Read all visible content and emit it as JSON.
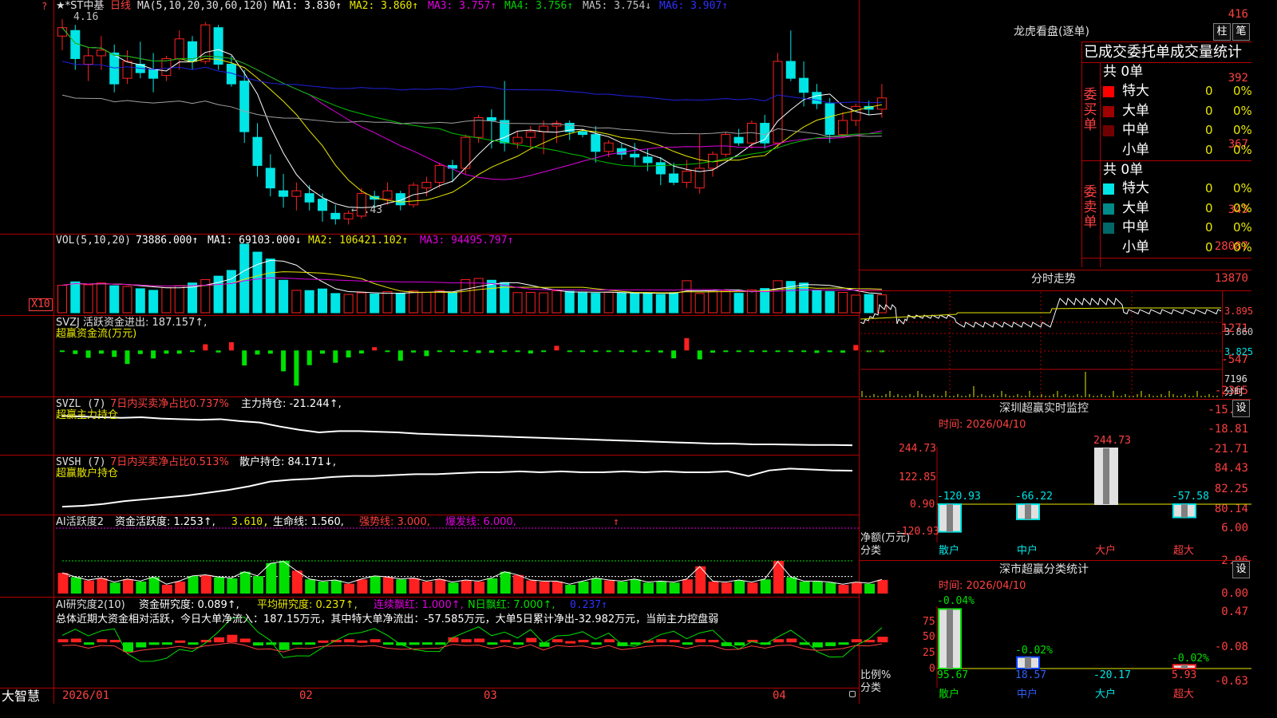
{
  "stock": {
    "name": "★*ST中基",
    "period": "日线",
    "bullet": "?"
  },
  "main": {
    "ma_label": "MA(5,10,20,30,60,120)",
    "ma1": "MA1: 3.830↑",
    "ma2": "MA2: 3.860↑",
    "ma3": "MA3: 3.757↑",
    "ma4": "MA4: 3.756↑",
    "ma5": "MA5: 3.754↓",
    "ma6": "MA6: 3.907↑",
    "yticks": [
      "416",
      "392",
      "367",
      "343"
    ],
    "high_mark": "4.16",
    "low_mark": "←3.43"
  },
  "vol": {
    "label": "VOL(5,10,20)",
    "val": "73886.000↑",
    "ma1": "MA1: 69103.000↓",
    "ma2": "MA2: 106421.102↑",
    "ma3": "MA3: 94495.797↑",
    "yticks": [
      "28087",
      "13870"
    ],
    "unit": "X10"
  },
  "svzj": {
    "label": "SVZJ  活跃资金进出: 187.157↑,",
    "sub": "超赢资金流(万元)",
    "yticks": [
      "1271",
      "-547",
      "-2365"
    ]
  },
  "svzl": {
    "label": "SVZL (7)",
    "pct": "7日内买卖净占比0.737%",
    "hold": "主力持仓: -21.244↑,",
    "sub": "超赢主力持仓",
    "yticks": [
      "-15.92",
      "-18.81",
      "-21.71"
    ]
  },
  "svsh": {
    "label": "SVSH (7)",
    "pct": "7日内买卖净占比0.513%",
    "hold": "散户持仓: 84.171↓,",
    "sub": "超赢散户持仓",
    "yticks": [
      "84.43",
      "82.25",
      "80.14"
    ]
  },
  "ai1": {
    "label": "AI活跃度2",
    "a": "资金活跃度: 1.253↑,",
    "b": "3.610,",
    "c": "生命线: 1.560,",
    "d": "强势线: 3.000,",
    "e": "爆发线: 6.000,",
    "f": "↑",
    "yticks": [
      "6.00",
      "2.96",
      "0.00"
    ]
  },
  "ai2": {
    "label": "AI研究度2(10)",
    "a": "资金研究度: 0.089↑,",
    "b": "平均研究度: 0.237↑,",
    "c": "连续飘红: 1.000↑,",
    "d": "N日飘红: 7.000↑,",
    "e": "0.237↑",
    "summary": "总体近期大资金相对活跃，今日大单净流入：187.15万元，其中特大单净流出：-57.585万元，大单5日累计净出-32.982万元，当前主力控盘弱",
    "yticks": [
      "0.47",
      "-0.08",
      "-0.63"
    ]
  },
  "xaxis": {
    "brand": "大智慧",
    "labels": [
      "2026/01",
      "02",
      "03",
      "04"
    ]
  },
  "side": {
    "title": "龙虎看盘(逐单)",
    "btn1": "柱",
    "btn2": "笔",
    "header": "已成交委托单成交量统计",
    "buy": {
      "label": "委买单",
      "count": "共 0单",
      "rows": [
        {
          "name": "特大",
          "v": "0",
          "p": "0%",
          "color": "#ff0000"
        },
        {
          "name": "大单",
          "v": "0",
          "p": "0%",
          "color": "#a00000"
        },
        {
          "name": "中单",
          "v": "0",
          "p": "0%",
          "color": "#700000"
        },
        {
          "name": "小单",
          "v": "0",
          "p": "0%",
          "color": "#000000"
        }
      ]
    },
    "sell": {
      "label": "委卖单",
      "count": "共 0单",
      "rows": [
        {
          "name": "特大",
          "v": "0",
          "p": "0%",
          "color": "#00e5e5"
        },
        {
          "name": "大单",
          "v": "0",
          "p": "0%",
          "color": "#008a8a"
        },
        {
          "name": "中单",
          "v": "0",
          "p": "0%",
          "color": "#006868"
        },
        {
          "name": "小单",
          "v": "0",
          "p": "0%",
          "color": "#000000"
        }
      ]
    },
    "intraday": {
      "title": "分时走势",
      "yticks": [
        "3.895",
        "3.860",
        "3.825"
      ],
      "vol": "7196",
      "unit": "分时"
    },
    "monitor": {
      "title": "深圳超赢实时监控",
      "btn": "设",
      "time": "时间: 2026/04/10",
      "yticks": [
        "244.73",
        "122.85",
        "0.90",
        "-120.93"
      ],
      "ylabel": "净额(万元)",
      "xlabel": "分类",
      "cats": [
        "散户",
        "中户",
        "大户",
        "超大"
      ],
      "vals": [
        "-120.93",
        "-66.22",
        "244.73",
        "-57.58"
      ]
    },
    "classify": {
      "title": "深市超赢分类统计",
      "btn": "设",
      "time": "时间: 2026/04/10",
      "yticks": [
        "75",
        "50",
        "25",
        "0"
      ],
      "ylabel": "比例%",
      "xlabel": "分类",
      "cats": [
        "散户",
        "中户",
        "大户",
        "超大"
      ],
      "tops": [
        "-0.04%",
        "-0.02%",
        "-0.02%"
      ],
      "vals": [
        "95.67",
        "18.57",
        "-20.17",
        "5.93"
      ]
    }
  },
  "colors": {
    "up": "#ff2020",
    "down": "#00e5e5",
    "green": "#00e000",
    "frame": "#b00000",
    "ma1": "#ffffff",
    "ma2": "#e8e800",
    "ma3": "#e000e0",
    "ma4": "#00c000",
    "ma5": "#a0a0a0",
    "ma6": "#2020e0"
  },
  "chart_data": [
    {
      "type": "candlestick",
      "title": "★*ST中基 日线",
      "ylim": [
        3.4,
        4.2
      ],
      "ohlc": [
        [
          4.1,
          4.16,
          4.05,
          4.13
        ],
        [
          4.12,
          4.14,
          3.98,
          4.02
        ],
        [
          4.0,
          4.06,
          3.94,
          4.03
        ],
        [
          4.03,
          4.1,
          3.98,
          4.05
        ],
        [
          4.04,
          4.07,
          3.9,
          3.93
        ],
        [
          3.95,
          4.05,
          3.93,
          4.01
        ],
        [
          4.0,
          4.08,
          3.95,
          3.97
        ],
        [
          3.98,
          4.04,
          3.9,
          3.95
        ],
        [
          3.96,
          4.03,
          3.94,
          4.02
        ],
        [
          4.02,
          4.12,
          3.98,
          4.09
        ],
        [
          4.08,
          4.1,
          3.98,
          4.01
        ],
        [
          4.01,
          4.15,
          4.0,
          4.14
        ],
        [
          4.13,
          4.14,
          3.98,
          4.0
        ],
        [
          4.0,
          4.03,
          3.92,
          3.93
        ],
        [
          3.94,
          3.98,
          3.72,
          3.76
        ],
        [
          3.74,
          3.79,
          3.6,
          3.64
        ],
        [
          3.63,
          3.68,
          3.53,
          3.56
        ],
        [
          3.55,
          3.61,
          3.49,
          3.53
        ],
        [
          3.53,
          3.58,
          3.48,
          3.55
        ],
        [
          3.54,
          3.57,
          3.48,
          3.51
        ],
        [
          3.52,
          3.54,
          3.44,
          3.48
        ],
        [
          3.47,
          3.5,
          3.43,
          3.45
        ],
        [
          3.45,
          3.48,
          3.43,
          3.47
        ],
        [
          3.46,
          3.56,
          3.45,
          3.54
        ],
        [
          3.53,
          3.55,
          3.49,
          3.52
        ],
        [
          3.52,
          3.58,
          3.5,
          3.55
        ],
        [
          3.54,
          3.55,
          3.48,
          3.5
        ],
        [
          3.5,
          3.58,
          3.49,
          3.57
        ],
        [
          3.56,
          3.6,
          3.53,
          3.58
        ],
        [
          3.58,
          3.65,
          3.56,
          3.64
        ],
        [
          3.64,
          3.66,
          3.58,
          3.63
        ],
        [
          3.63,
          3.75,
          3.61,
          3.74
        ],
        [
          3.74,
          3.82,
          3.72,
          3.81
        ],
        [
          3.81,
          3.84,
          3.7,
          3.8
        ],
        [
          3.8,
          3.94,
          3.69,
          3.72
        ],
        [
          3.72,
          3.76,
          3.7,
          3.74
        ],
        [
          3.74,
          3.78,
          3.7,
          3.76
        ],
        [
          3.76,
          3.8,
          3.68,
          3.78
        ],
        [
          3.78,
          3.8,
          3.72,
          3.79
        ],
        [
          3.79,
          3.8,
          3.73,
          3.76
        ],
        [
          3.76,
          3.77,
          3.74,
          3.75
        ],
        [
          3.75,
          3.78,
          3.65,
          3.69
        ],
        [
          3.69,
          3.73,
          3.67,
          3.72
        ],
        [
          3.7,
          3.72,
          3.66,
          3.68
        ],
        [
          3.68,
          3.72,
          3.64,
          3.67
        ],
        [
          3.67,
          3.7,
          3.62,
          3.65
        ],
        [
          3.65,
          3.67,
          3.57,
          3.61
        ],
        [
          3.61,
          3.65,
          3.57,
          3.58
        ],
        [
          3.58,
          3.66,
          3.56,
          3.62
        ],
        [
          3.56,
          3.75,
          3.54,
          3.63
        ],
        [
          3.63,
          3.69,
          3.6,
          3.68
        ],
        [
          3.68,
          3.76,
          3.67,
          3.75
        ],
        [
          3.74,
          3.77,
          3.71,
          3.72
        ],
        [
          3.72,
          3.8,
          3.7,
          3.79
        ],
        [
          3.79,
          3.82,
          3.7,
          3.72
        ],
        [
          3.72,
          4.04,
          3.7,
          4.01
        ],
        [
          4.01,
          4.12,
          3.94,
          3.95
        ],
        [
          3.95,
          4.01,
          3.85,
          3.9
        ],
        [
          3.9,
          3.93,
          3.84,
          3.86
        ],
        [
          3.86,
          3.88,
          3.72,
          3.75
        ],
        [
          3.75,
          3.83,
          3.74,
          3.8
        ],
        [
          3.8,
          3.86,
          3.78,
          3.85
        ],
        [
          3.85,
          3.87,
          3.82,
          3.84
        ],
        [
          3.84,
          3.93,
          3.81,
          3.88
        ]
      ]
    },
    {
      "type": "bar",
      "title": "VOL(5,10,20)",
      "ylim": [
        0,
        30000
      ],
      "values": [
        12000,
        13500,
        12200,
        13000,
        11800,
        11500,
        10500,
        9800,
        11000,
        11800,
        13000,
        14500,
        16000,
        18500,
        30000,
        26500,
        23500,
        14200,
        9800,
        9700,
        10400,
        8400,
        8000,
        8700,
        8200,
        9200,
        8500,
        9500,
        9000,
        9700,
        8800,
        14500,
        15000,
        14200,
        13200,
        8800,
        8900,
        8700,
        9600,
        9400,
        8700,
        8500,
        8900,
        8600,
        8400,
        8600,
        8000,
        8800,
        14000,
        8400,
        9200,
        9700,
        8500,
        10000,
        10600,
        14000,
        13700,
        13000,
        9800,
        9300,
        8900,
        7700,
        8000,
        7800
      ]
    },
    {
      "type": "bar",
      "title": "超赢资金流(万元)",
      "ylim": [
        -2365,
        1271
      ],
      "values": [
        -80,
        -210,
        -430,
        -190,
        -380,
        -790,
        -210,
        -470,
        -190,
        -190,
        -95,
        360,
        -120,
        480,
        -880,
        -240,
        -190,
        -1220,
        -2060,
        -860,
        -190,
        -720,
        -410,
        -180,
        190,
        -95,
        -600,
        -120,
        -330,
        -95,
        -45,
        -45,
        -150,
        -140,
        -80,
        -95,
        -180,
        -95,
        270,
        -95,
        -95,
        -90,
        -95,
        -45,
        -100,
        -45,
        -120,
        -460,
        720,
        -520,
        -130,
        -95,
        -20,
        -95,
        -45,
        -90,
        -45,
        -95,
        -145,
        -100,
        -130,
        320,
        -95,
        -100
      ]
    },
    {
      "type": "line",
      "title": "超赢主力持仓",
      "ylim": [
        -21.71,
        -15.92
      ],
      "values": [
        -16.8,
        -16.9,
        -17.0,
        -17.1,
        -17.0,
        -17.2,
        -17.3,
        -17.4,
        -17.3,
        -17.6,
        -17.8,
        -18.4,
        -18.9,
        -19.3,
        -19.1,
        -19.1,
        -19.2,
        -19.3,
        -19.5,
        -19.6,
        -19.7,
        -19.8,
        -19.9,
        -20.0,
        -20.1,
        -20.2,
        -20.3,
        -20.4,
        -20.5,
        -20.6,
        -20.7,
        -20.8,
        -20.9,
        -21.0,
        -21.0,
        -21.1,
        -21.1,
        -21.15,
        -21.2,
        -21.2,
        -21.244
      ]
    },
    {
      "type": "line",
      "title": "超赢散户持仓",
      "ylim": [
        80.14,
        84.43
      ],
      "values": [
        80.3,
        80.4,
        80.6,
        80.9,
        81.1,
        81.3,
        81.5,
        81.8,
        82.1,
        82.5,
        83.0,
        83.2,
        83.3,
        83.5,
        83.6,
        83.6,
        83.7,
        83.8,
        83.8,
        83.9,
        84.0,
        84.0,
        84.1,
        84.0,
        84.1,
        84.0,
        84.0,
        84.1,
        84.0,
        84.1,
        84.0,
        84.0,
        84.1,
        83.6,
        84.2,
        84.4,
        84.3,
        84.2,
        84.171
      ]
    },
    {
      "type": "bar",
      "title": "AI活跃度2",
      "ylim": [
        0,
        6.0
      ],
      "values": [
        1.9,
        1.5,
        1.2,
        1.4,
        1.0,
        1.3,
        1.1,
        1.5,
        0.8,
        1.1,
        1.6,
        1.7,
        1.5,
        1.4,
        2.0,
        1.6,
        2.8,
        3.0,
        2.1,
        1.3,
        1.1,
        1.2,
        0.9,
        1.3,
        1.6,
        1.5,
        1.3,
        1.4,
        1.1,
        1.3,
        1.0,
        1.2,
        1.1,
        1.4,
        2.0,
        1.7,
        1.2,
        1.1,
        1.1,
        0.8,
        1.1,
        1.4,
        1.2,
        1.1,
        1.3,
        1.0,
        1.1,
        1.0,
        1.3,
        2.5,
        1.1,
        1.0,
        1.2,
        1.0,
        1.3,
        3.0,
        1.5,
        1.1,
        1.1,
        1.0,
        0.8,
        1.0,
        0.9,
        1.253
      ]
    },
    {
      "type": "bar",
      "title": "AI研究度2(10)",
      "ylim": [
        -0.63,
        0.47
      ],
      "values": [
        0.05,
        0.06,
        -0.02,
        0.05,
        0.04,
        -0.15,
        -0.08,
        -0.04,
        -0.02,
        0.03,
        -0.03,
        0.04,
        0.08,
        0.12,
        0.06,
        -0.05,
        -0.04,
        -0.12,
        -0.02,
        -0.03,
        0.03,
        0.04,
        0.05,
        0.03,
        0.05,
        -0.02,
        -0.05,
        -0.04,
        -0.03,
        -0.02,
        0.08,
        0.05,
        0.06,
        -0.03,
        0.04,
        -0.02,
        0.07,
        -0.07,
        0.05,
        0.02,
        0.04,
        -0.03,
        0.05,
        -0.06,
        -0.02,
        0.03,
        0.05,
        0.04,
        -0.03,
        0.05,
        0.04,
        -0.06,
        -0.05,
        0.04,
        -0.02,
        0.05,
        0.06,
        -0.04,
        -0.08,
        -0.06,
        -0.03,
        0.05,
        0.04,
        0.089
      ]
    },
    {
      "type": "bar",
      "title": "深圳超赢实时监控",
      "categories": [
        "散户",
        "中户",
        "大户",
        "超大"
      ],
      "values": [
        -120.93,
        -66.22,
        244.73,
        -57.58
      ],
      "ylim": [
        -120.93,
        244.73
      ]
    },
    {
      "type": "bar",
      "title": "深市超赢分类统计",
      "categories": [
        "散户",
        "中户",
        "大户",
        "超大"
      ],
      "values": [
        95.67,
        18.57,
        -20.17,
        5.93
      ],
      "ylim": [
        0,
        100
      ]
    }
  ]
}
